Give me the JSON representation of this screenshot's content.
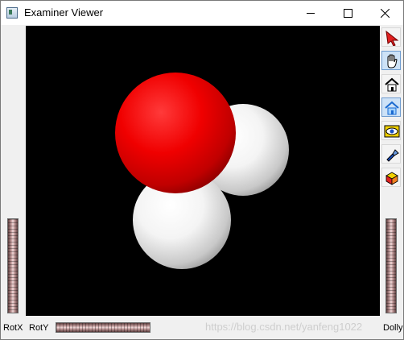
{
  "window": {
    "title": "Examiner Viewer",
    "icon": "app-window-icon",
    "controls": [
      "minimize-icon",
      "maximize-icon",
      "close-icon"
    ]
  },
  "viewport": {
    "background": "#000000",
    "molecule": {
      "atoms": [
        {
          "element": "H",
          "color": "#ffffff"
        },
        {
          "element": "O",
          "color": "#ff0000"
        },
        {
          "element": "H",
          "color": "#ffffff"
        }
      ]
    }
  },
  "toolbar": {
    "tools": [
      {
        "name": "pick-arrow-icon",
        "active": false
      },
      {
        "name": "hand-view-icon",
        "active": true
      },
      {
        "name": "home-icon",
        "active": false
      },
      {
        "name": "set-home-icon",
        "active": true
      },
      {
        "name": "view-all-icon",
        "active": false
      },
      {
        "name": "seek-flashlight-icon",
        "active": false
      },
      {
        "name": "projection-cube-icon",
        "active": false
      }
    ]
  },
  "wheels": {
    "rotx_label": "RotX",
    "roty_label": "RotY",
    "dolly_label": "Dolly"
  },
  "watermark": "https://blog.csdn.net/yanfeng1022"
}
